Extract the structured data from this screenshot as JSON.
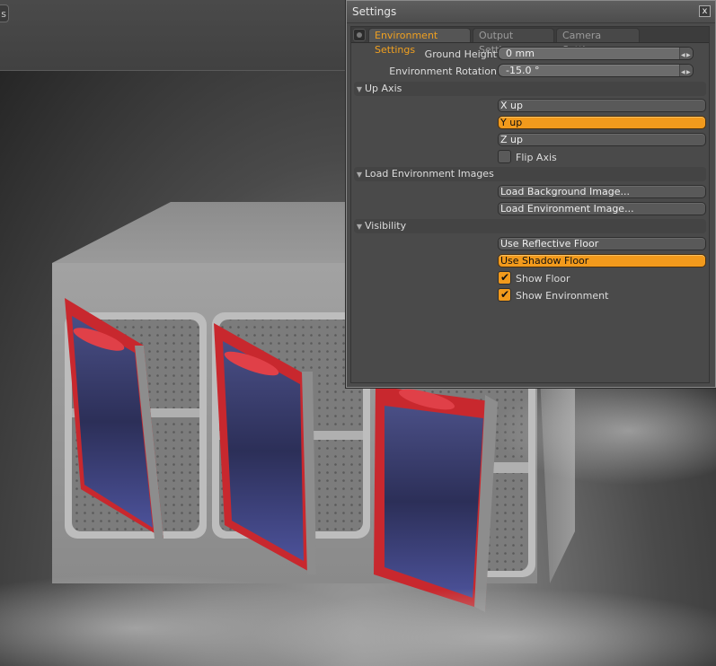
{
  "app": {
    "top_button_label": "s"
  },
  "settings": {
    "title": "Settings",
    "close_label": "x",
    "tabs": [
      {
        "label": "Environment Settings",
        "active": true
      },
      {
        "label": "Output Settings",
        "active": false
      },
      {
        "label": "Camera Settings",
        "active": false
      }
    ],
    "ground_height": {
      "label": "Ground Height",
      "value": "0 mm"
    },
    "environment_rotation": {
      "label": "Environment Rotation",
      "value": "-15.0 °"
    },
    "up_axis": {
      "title": "Up Axis",
      "options": [
        {
          "label": "X up",
          "selected": false
        },
        {
          "label": "Y up",
          "selected": true
        },
        {
          "label": "Z up",
          "selected": false
        }
      ],
      "flip_axis": {
        "label": "Flip Axis",
        "checked": false
      }
    },
    "load_images": {
      "title": "Load Environment Images",
      "background_button": "Load Background Image...",
      "environment_button": "Load Environment Image..."
    },
    "visibility": {
      "title": "Visibility",
      "reflective_floor": {
        "label": "Use Reflective Floor",
        "on": false
      },
      "shadow_floor": {
        "label": "Use Shadow Floor",
        "on": true
      },
      "show_floor": {
        "label": "Show Floor",
        "checked": true
      },
      "show_environment": {
        "label": "Show Environment",
        "checked": true
      }
    }
  },
  "colors": {
    "accent": "#f29a1c",
    "panel": "#4b4b4b",
    "door_red": "#c8282e",
    "glass_blue": "#3a3f7a"
  }
}
